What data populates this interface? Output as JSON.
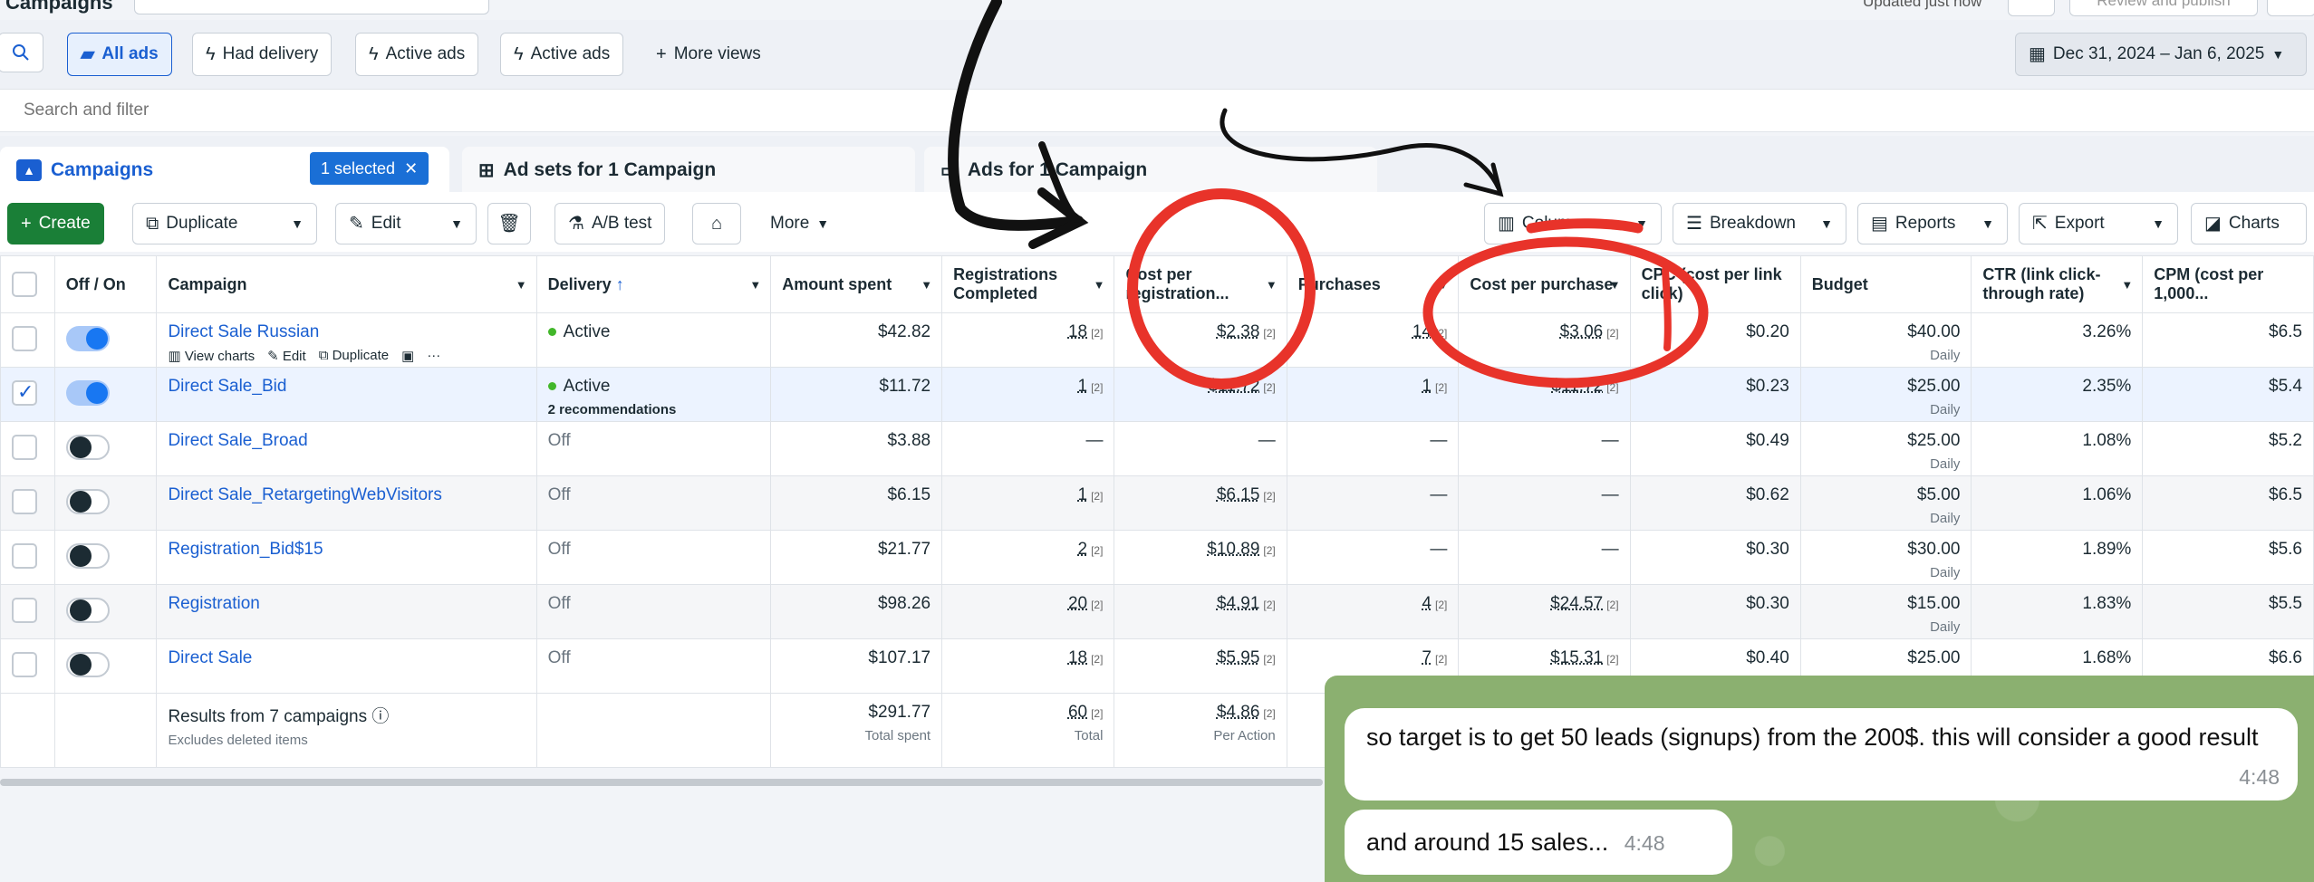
{
  "top": {
    "page_title": "Campaigns",
    "updated": "Updated just now",
    "review_publish": "Review and publish"
  },
  "views": {
    "all_ads": "All ads",
    "had_delivery": "Had delivery",
    "active_ads_1": "Active ads",
    "active_ads_2": "Active ads",
    "more_views": "More views",
    "date_range": "Dec 31, 2024 – Jan 6, 2025"
  },
  "search": {
    "placeholder": "Search and filter"
  },
  "tabs": {
    "campaigns": "Campaigns",
    "selected": "1 selected",
    "adsets": "Ad sets for 1 Campaign",
    "ads": "Ads for 1 Campaign"
  },
  "toolbar": {
    "create": "Create",
    "duplicate": "Duplicate",
    "edit": "Edit",
    "abtest": "A/B test",
    "more": "More",
    "columns": "Columns",
    "breakdown": "Breakdown",
    "reports": "Reports",
    "export": "Export",
    "charts": "Charts"
  },
  "columns": {
    "offon": "Off / On",
    "campaign": "Campaign",
    "delivery": "Delivery",
    "amount": "Amount spent",
    "registrations": "Registrations Completed",
    "cost_reg": "Cost per registration...",
    "purchases": "Purchases",
    "cost_purchase": "Cost per purchase",
    "cpc": "CPC (cost per link click)",
    "budget": "Budget",
    "ctr": "CTR (link click-through rate)",
    "cpm": "CPM (cost per 1,000..."
  },
  "row_actions": {
    "view_charts": "View charts",
    "edit": "Edit",
    "duplicate": "Duplicate",
    "more": "···"
  },
  "rows": [
    {
      "name": "Direct Sale Russian",
      "delivery": "Active",
      "delivery_sub": "",
      "amount": "$42.82",
      "reg": "18",
      "cost_reg": "$2.38",
      "purch": "14",
      "cost_purch": "$3.06",
      "cpc": "$0.20",
      "budget": "$40.00",
      "budget_sub": "Daily",
      "ctr": "3.26%",
      "cpm": "$6.5"
    },
    {
      "name": "Direct Sale_Bid",
      "delivery": "Active",
      "delivery_sub": "2 recommendations",
      "amount": "$11.72",
      "reg": "1",
      "cost_reg": "$11.72",
      "purch": "1",
      "cost_purch": "$11.72",
      "cpc": "$0.23",
      "budget": "$25.00",
      "budget_sub": "Daily",
      "ctr": "2.35%",
      "cpm": "$5.4"
    },
    {
      "name": "Direct Sale_Broad",
      "delivery": "Off",
      "delivery_sub": "",
      "amount": "$3.88",
      "reg": "—",
      "cost_reg": "—",
      "purch": "—",
      "cost_purch": "—",
      "cpc": "$0.49",
      "budget": "$25.00",
      "budget_sub": "Daily",
      "ctr": "1.08%",
      "cpm": "$5.2"
    },
    {
      "name": "Direct Sale_RetargetingWebVisitors",
      "delivery": "Off",
      "delivery_sub": "",
      "amount": "$6.15",
      "reg": "1",
      "cost_reg": "$6.15",
      "purch": "—",
      "cost_purch": "—",
      "cpc": "$0.62",
      "budget": "$5.00",
      "budget_sub": "Daily",
      "ctr": "1.06%",
      "cpm": "$6.5"
    },
    {
      "name": "Registration_Bid$15",
      "delivery": "Off",
      "delivery_sub": "",
      "amount": "$21.77",
      "reg": "2",
      "cost_reg": "$10.89",
      "purch": "—",
      "cost_purch": "—",
      "cpc": "$0.30",
      "budget": "$30.00",
      "budget_sub": "Daily",
      "ctr": "1.89%",
      "cpm": "$5.6"
    },
    {
      "name": "Registration",
      "delivery": "Off",
      "delivery_sub": "",
      "amount": "$98.26",
      "reg": "20",
      "cost_reg": "$4.91",
      "purch": "4",
      "cost_purch": "$24.57",
      "cpc": "$0.30",
      "budget": "$15.00",
      "budget_sub": "Daily",
      "ctr": "1.83%",
      "cpm": "$5.5"
    },
    {
      "name": "Direct Sale",
      "delivery": "Off",
      "delivery_sub": "",
      "amount": "$107.17",
      "reg": "18",
      "cost_reg": "$5.95",
      "purch": "7",
      "cost_purch": "$15.31",
      "cpc": "$0.40",
      "budget": "$25.00",
      "budget_sub": "",
      "ctr": "1.68%",
      "cpm": "$6.6"
    }
  ],
  "totals": {
    "label": "Results from 7 campaigns",
    "sub": "Excludes deleted items",
    "amount": "$291.77",
    "amount_sub": "Total spent",
    "reg": "60",
    "reg_sub": "Total",
    "cost_reg": "$4.86",
    "cost_reg_sub": "Per Action"
  },
  "chat": {
    "msg1": "so target is to get 50 leads (signups) from the 200$. this will consider a good result",
    "time1": "4:48",
    "msg2": "and around 15 sales...",
    "time2": "4:48"
  },
  "colors": {
    "accent": "#1877f2",
    "create_green": "#1a7f37",
    "annotation_red": "#e8332a",
    "chat_bg": "#8bb070"
  }
}
